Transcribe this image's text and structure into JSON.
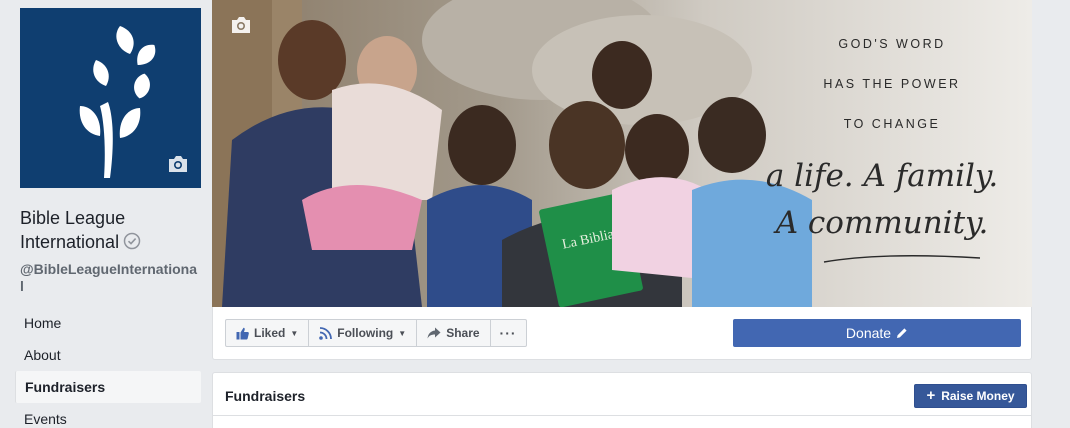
{
  "page": {
    "name": "Bible League International",
    "handle": "@BibleLeagueInternational"
  },
  "nav": {
    "items": [
      {
        "label": "Home"
      },
      {
        "label": "About"
      },
      {
        "label": "Fundraisers"
      },
      {
        "label": "Events"
      }
    ]
  },
  "cover": {
    "line1": "GOD'S WORD",
    "line2": "HAS THE POWER",
    "line3": "TO CHANGE",
    "script1": "a life. A family.",
    "script2": "A community.",
    "book_title": "La Biblia"
  },
  "actions": {
    "liked": "Liked",
    "following": "Following",
    "share": "Share",
    "more": "···",
    "donate": "Donate"
  },
  "fundraisers": {
    "title": "Fundraisers",
    "raise_money": "Raise Money"
  },
  "colors": {
    "brand_navy": "#0f3e70",
    "facebook_blue": "#4267b2",
    "raise_blue": "#365899",
    "background": "#e9ebee"
  }
}
